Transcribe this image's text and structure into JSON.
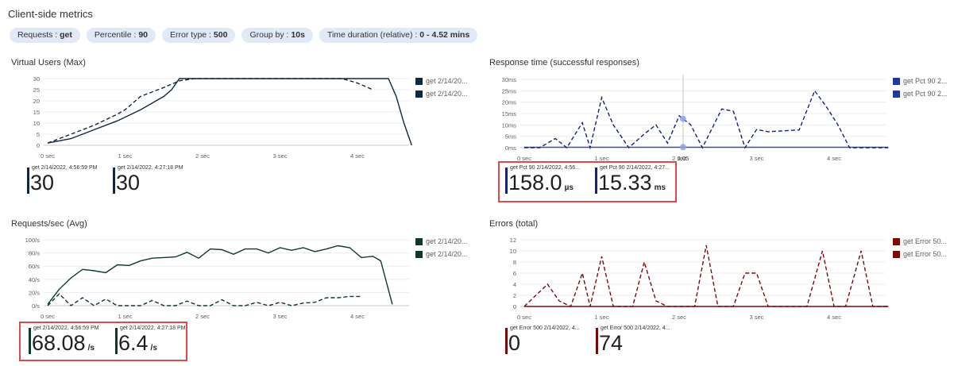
{
  "page": {
    "title": "Client-side metrics"
  },
  "filters": [
    {
      "name": "Requests",
      "value": "get"
    },
    {
      "name": "Percentile",
      "value": "90"
    },
    {
      "name": "Error type",
      "value": "500"
    },
    {
      "name": "Group by",
      "value": "10s"
    },
    {
      "name": "Time duration (relative)",
      "value": "0 - 4.52 mins"
    }
  ],
  "panels": {
    "vu": {
      "title": "Virtual Users (Max)",
      "legend": [
        "get 2/14/20...",
        "get 2/14/20..."
      ],
      "metrics": [
        {
          "label": "get 2/14/2022, 4:56:59 PM",
          "value": "30",
          "unit": ""
        },
        {
          "label": "get 2/14/2022, 4:27:18 PM",
          "value": "30",
          "unit": ""
        }
      ]
    },
    "rt": {
      "title": "Response time (successful responses)",
      "legend": [
        "get Pct 90 2...",
        "get Pct 90 2..."
      ],
      "metrics": [
        {
          "label": "get Pct 90 2/14/2022, 4:56...",
          "value": "158.0",
          "unit": "µs"
        },
        {
          "label": "get Pct 90 2/14/2022, 4:27...",
          "value": "15.33",
          "unit": "ms"
        }
      ]
    },
    "rps": {
      "title": "Requests/sec (Avg)",
      "legend": [
        "get 2/14/20...",
        "get 2/14/20..."
      ],
      "metrics": [
        {
          "label": "get 2/14/2022, 4:56:59 PM",
          "value": "68.08",
          "unit": "/s"
        },
        {
          "label": "get 2/14/2022, 4:27:18 PM",
          "value": "6.4",
          "unit": "/s"
        }
      ]
    },
    "err": {
      "title": "Errors (total)",
      "legend": [
        "get Error 50...",
        "get Error 50..."
      ],
      "metrics": [
        {
          "label": "get Error 500 2/14/2022, 4...",
          "value": "0",
          "unit": ""
        },
        {
          "label": "get Error 500 2/14/2022, 4...",
          "value": "74",
          "unit": ""
        }
      ]
    }
  },
  "colors": {
    "vu": "#0e2841",
    "rt_solid": "#2f4fb4",
    "rt_dashed": "#13237a",
    "rps": "#0b3a26",
    "err": "#7a0a0a",
    "highlight": "#e0474c",
    "pill_bg": "#dfeaf6"
  },
  "chart_data": [
    {
      "id": "vu",
      "type": "line",
      "title": "Virtual Users (Max)",
      "x_ticks": [
        "0 sec",
        "1 sec",
        "2 sec",
        "3 sec",
        "4 sec"
      ],
      "y_ticks": [
        "0",
        "5",
        "10",
        "15",
        "20",
        "25",
        "30"
      ],
      "xlim": [
        0,
        4.7
      ],
      "ylim": [
        0,
        30
      ],
      "series": [
        {
          "style": "solid",
          "points": [
            [
              0,
              1
            ],
            [
              0.3,
              3
            ],
            [
              0.6,
              7
            ],
            [
              0.9,
              11
            ],
            [
              1.2,
              16
            ],
            [
              1.5,
              22
            ],
            [
              1.6,
              25
            ],
            [
              1.7,
              30
            ],
            [
              2.0,
              30
            ],
            [
              3.0,
              30
            ],
            [
              4.0,
              30
            ],
            [
              4.4,
              30
            ],
            [
              4.5,
              22
            ],
            [
              4.6,
              10
            ],
            [
              4.7,
              0
            ]
          ]
        },
        {
          "style": "dashed",
          "points": [
            [
              0,
              1
            ],
            [
              0.3,
              5
            ],
            [
              0.6,
              9
            ],
            [
              0.9,
              14
            ],
            [
              1.0,
              16
            ],
            [
              1.2,
              22
            ],
            [
              1.5,
              26
            ],
            [
              1.7,
              29
            ],
            [
              1.9,
              30
            ],
            [
              3.0,
              30
            ],
            [
              3.5,
              30
            ],
            [
              3.8,
              30
            ],
            [
              4.0,
              28
            ],
            [
              4.2,
              25
            ]
          ]
        }
      ]
    },
    {
      "id": "rt",
      "type": "line",
      "title": "Response time (successful responses)",
      "x_ticks": [
        "0 sec",
        "1 sec",
        "2 sec",
        "3 sec",
        "4 sec"
      ],
      "y_ticks": [
        "0ms",
        "5ms",
        "10ms",
        "15ms",
        "20ms",
        "25ms",
        "30ms"
      ],
      "xlim": [
        0,
        4.7
      ],
      "ylim": [
        0,
        30
      ],
      "crosshair": {
        "x": 2.05,
        "label": "2.05"
      },
      "series": [
        {
          "style": "solid",
          "points": [
            [
              0,
              0.2
            ],
            [
              1,
              0.2
            ],
            [
              2,
              0.2
            ],
            [
              3,
              0.2
            ],
            [
              4,
              0.2
            ],
            [
              4.7,
              0.2
            ]
          ]
        },
        {
          "style": "dashed",
          "points": [
            [
              0,
              0
            ],
            [
              0.2,
              0
            ],
            [
              0.4,
              4
            ],
            [
              0.55,
              0
            ],
            [
              0.75,
              11
            ],
            [
              0.85,
              0
            ],
            [
              1.0,
              22
            ],
            [
              1.15,
              10
            ],
            [
              1.35,
              0
            ],
            [
              1.55,
              6
            ],
            [
              1.7,
              10
            ],
            [
              1.85,
              2
            ],
            [
              2.0,
              14
            ],
            [
              2.15,
              10
            ],
            [
              2.3,
              0
            ],
            [
              2.55,
              17
            ],
            [
              2.7,
              16
            ],
            [
              2.85,
              0
            ],
            [
              3.0,
              8
            ],
            [
              3.15,
              7
            ],
            [
              3.4,
              7.5
            ],
            [
              3.55,
              7.8
            ],
            [
              3.75,
              25
            ],
            [
              3.9,
              18
            ],
            [
              4.05,
              10
            ],
            [
              4.2,
              0
            ],
            [
              4.7,
              0
            ]
          ]
        }
      ]
    },
    {
      "id": "rps",
      "type": "line",
      "title": "Requests/sec (Avg)",
      "x_ticks": [
        "0 sec",
        "1 sec",
        "2 sec",
        "3 sec",
        "4 sec"
      ],
      "y_ticks": [
        "0/s",
        "20/s",
        "40/s",
        "60/s",
        "80/s",
        "100/s"
      ],
      "xlim": [
        0,
        4.7
      ],
      "ylim": [
        0,
        100
      ],
      "series": [
        {
          "style": "solid",
          "points": [
            [
              0,
              2
            ],
            [
              0.15,
              25
            ],
            [
              0.3,
              42
            ],
            [
              0.45,
              55
            ],
            [
              0.6,
              53
            ],
            [
              0.75,
              50
            ],
            [
              0.9,
              62
            ],
            [
              1.05,
              61
            ],
            [
              1.2,
              68
            ],
            [
              1.35,
              72
            ],
            [
              1.5,
              73
            ],
            [
              1.65,
              74
            ],
            [
              1.8,
              81
            ],
            [
              1.95,
              72
            ],
            [
              2.1,
              86
            ],
            [
              2.25,
              85
            ],
            [
              2.4,
              78
            ],
            [
              2.55,
              86
            ],
            [
              2.7,
              86
            ],
            [
              2.85,
              80
            ],
            [
              3.0,
              88
            ],
            [
              3.15,
              84
            ],
            [
              3.3,
              88
            ],
            [
              3.45,
              82
            ],
            [
              3.6,
              86
            ],
            [
              3.75,
              91
            ],
            [
              3.9,
              88
            ],
            [
              4.05,
              73
            ],
            [
              4.2,
              75
            ],
            [
              4.3,
              68
            ],
            [
              4.45,
              2
            ]
          ]
        },
        {
          "style": "dashed",
          "points": [
            [
              0,
              0
            ],
            [
              0.15,
              18
            ],
            [
              0.3,
              0
            ],
            [
              0.45,
              12
            ],
            [
              0.6,
              0
            ],
            [
              0.75,
              10
            ],
            [
              0.9,
              0
            ],
            [
              1.05,
              0
            ],
            [
              1.2,
              0
            ],
            [
              1.35,
              8
            ],
            [
              1.5,
              0
            ],
            [
              1.65,
              0
            ],
            [
              1.8,
              7
            ],
            [
              1.95,
              0
            ],
            [
              2.1,
              0
            ],
            [
              2.25,
              9
            ],
            [
              2.4,
              0
            ],
            [
              2.55,
              0
            ],
            [
              2.7,
              5
            ],
            [
              2.85,
              0
            ],
            [
              3.0,
              5
            ],
            [
              3.15,
              0
            ],
            [
              3.3,
              4
            ],
            [
              3.45,
              5
            ],
            [
              3.6,
              12
            ],
            [
              3.75,
              12
            ],
            [
              3.9,
              14
            ],
            [
              4.05,
              14
            ]
          ]
        }
      ]
    },
    {
      "id": "err",
      "type": "line",
      "title": "Errors (total)",
      "x_ticks": [
        "0 sec",
        "1 sec",
        "2 sec",
        "3 sec",
        "4 sec"
      ],
      "y_ticks": [
        "0",
        "2",
        "4",
        "6",
        "8",
        "10",
        "12"
      ],
      "xlim": [
        0,
        4.7
      ],
      "ylim": [
        0,
        12
      ],
      "series": [
        {
          "style": "solid",
          "points": [
            [
              0,
              0
            ],
            [
              1,
              0
            ],
            [
              2,
              0
            ],
            [
              3,
              0
            ],
            [
              4,
              0
            ],
            [
              4.7,
              0
            ]
          ]
        },
        {
          "style": "dashed",
          "points": [
            [
              0,
              0
            ],
            [
              0.15,
              2
            ],
            [
              0.3,
              4
            ],
            [
              0.45,
              1
            ],
            [
              0.6,
              0
            ],
            [
              0.75,
              6
            ],
            [
              0.85,
              0
            ],
            [
              1.0,
              9
            ],
            [
              1.15,
              0
            ],
            [
              1.25,
              0
            ],
            [
              1.4,
              0
            ],
            [
              1.55,
              8
            ],
            [
              1.7,
              1
            ],
            [
              1.85,
              0
            ],
            [
              2.05,
              0
            ],
            [
              2.2,
              0
            ],
            [
              2.35,
              11
            ],
            [
              2.5,
              0
            ],
            [
              2.7,
              0
            ],
            [
              2.85,
              6
            ],
            [
              3.0,
              6
            ],
            [
              3.15,
              0
            ],
            [
              3.3,
              0
            ],
            [
              3.5,
              0
            ],
            [
              3.65,
              0
            ],
            [
              3.85,
              10
            ],
            [
              4.0,
              0
            ],
            [
              4.15,
              0
            ],
            [
              4.35,
              10
            ],
            [
              4.5,
              0
            ],
            [
              4.7,
              0
            ]
          ]
        }
      ]
    }
  ]
}
